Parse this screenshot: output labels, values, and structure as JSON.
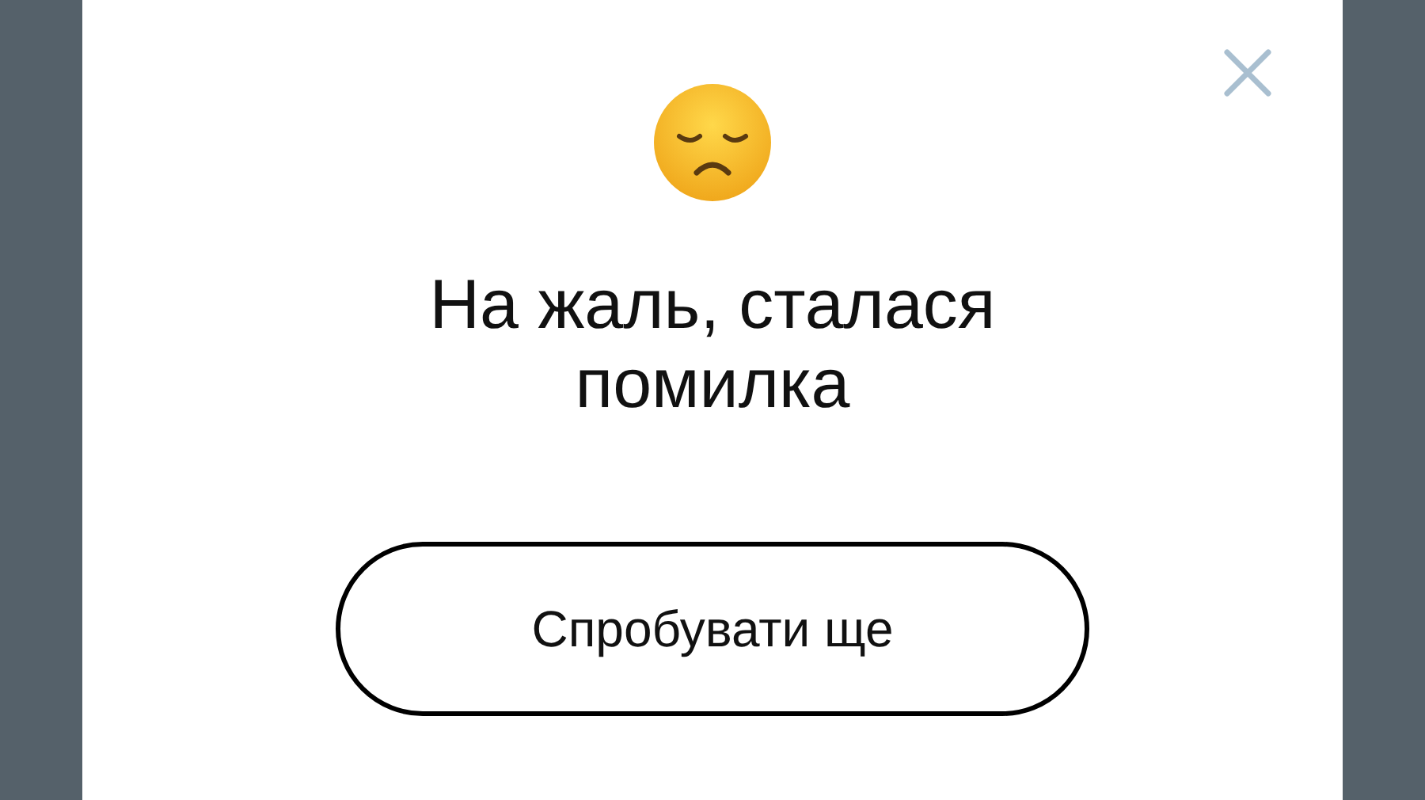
{
  "dialog": {
    "title": "На жаль, сталася помилка",
    "button": "Спробувати ще"
  }
}
